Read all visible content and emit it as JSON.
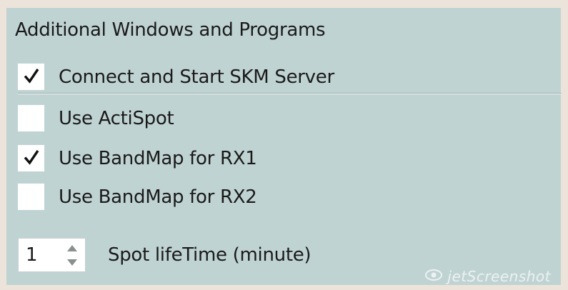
{
  "panel": {
    "title": "Additional Windows and Programs",
    "options": [
      {
        "label": "Connect and Start SKM Server",
        "checked": true
      },
      {
        "label": "Use ActiSpot",
        "checked": false
      },
      {
        "label": "Use BandMap for RX1",
        "checked": true
      },
      {
        "label": "Use BandMap for RX2",
        "checked": false
      }
    ],
    "spot_lifetime": {
      "value": "1",
      "label": "Spot lifeTime (minute)"
    }
  },
  "watermark": "jetScreenshot",
  "colors": {
    "window_bg": "#ece4da",
    "panel_bg": "#c0d3d3",
    "checkbox_bg": "#ffffff",
    "text": "#1a1a1a"
  },
  "icons": {
    "check": "check-icon",
    "spin_up": "triangle-up-icon",
    "spin_down": "triangle-down-icon"
  }
}
